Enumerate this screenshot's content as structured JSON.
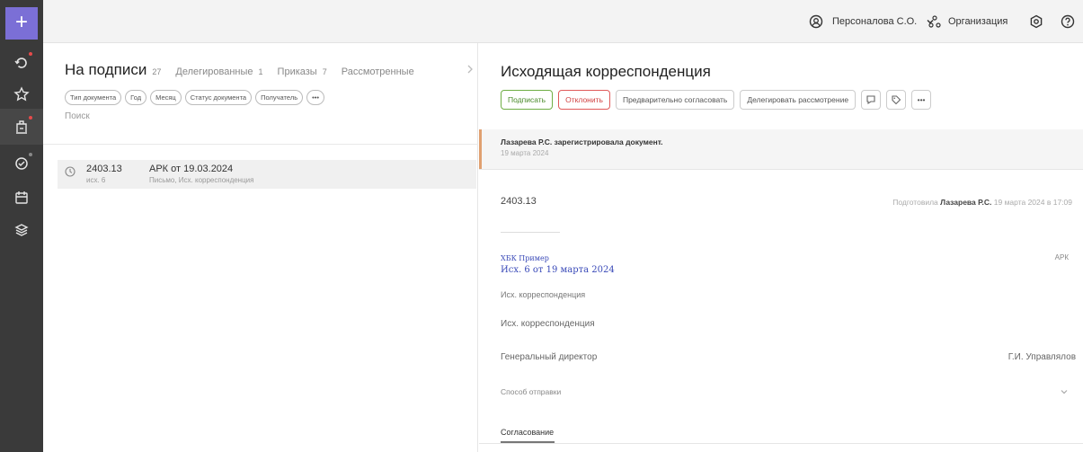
{
  "rail": {
    "items": [
      "plus-icon",
      "history-icon",
      "star-icon",
      "document-sign-icon",
      "circle-check-icon",
      "calendar-icon",
      "layers-icon"
    ]
  },
  "topbar": {
    "user_name": "Персоналова С.О.",
    "organization_label": "Организация"
  },
  "list": {
    "tab_main": "На подписи",
    "tab_main_count": "27",
    "tabs": [
      {
        "label": "Делегированные",
        "count": "1"
      },
      {
        "label": "Приказы",
        "count": "7"
      },
      {
        "label": "Рассмотренные",
        "count": ""
      }
    ],
    "filters": [
      "Тип документа",
      "Год",
      "Месяц",
      "Статус документа",
      "Получатель",
      "•••"
    ],
    "search_placeholder": "Поиск",
    "rows": [
      {
        "number": "2403.13",
        "sub": "исх. 6",
        "title": "АРК от 19.03.2024",
        "desc": "Письмо, Исх. корреспонденция"
      }
    ]
  },
  "doc": {
    "title": "Исходящая корреспонденция",
    "actions": {
      "sign": "Подписать",
      "reject": "Отклонить",
      "preapprove": "Предварительно согласовать",
      "delegate": "Делегировать рассмотрение",
      "more": "•••"
    },
    "history_text": "Лазарева Р.С. зарегистрировала документ.",
    "history_date": "19 марта 2024",
    "reg_number": "2403.13",
    "prepared_prefix": "Подготовила",
    "prepared_by": "Лазарева Р.С.",
    "prepared_date": "19 марта 2024 в 17:09",
    "correspondent": "ХБК Пример",
    "outgoing": "Исх. 6 от 19 марта 2024",
    "apk": "АРК",
    "field1": "Исх. корреспонденция",
    "field2": "Исх. корреспонденция",
    "position": "Генеральный директор",
    "signer": "Г.И. Управлялов",
    "delivery_label": "Способ отправки",
    "section_tab": "Согласование"
  }
}
